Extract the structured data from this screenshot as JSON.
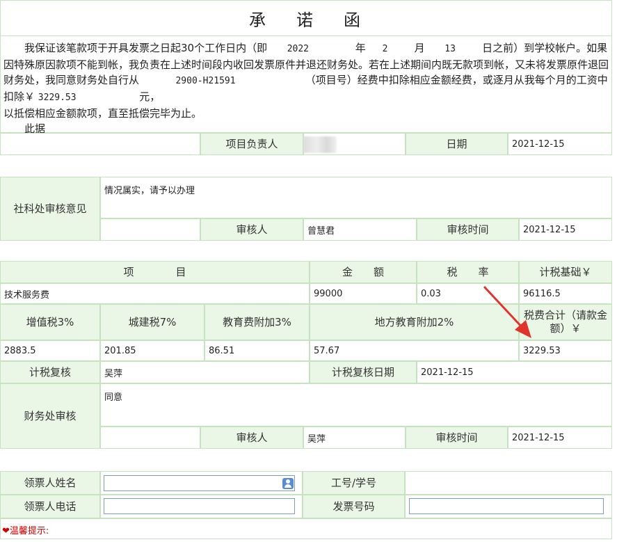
{
  "title": {
    "part1": "承",
    "part2": "诺",
    "part3": "函"
  },
  "pledge": {
    "text1": "我保证该笔款项于开具发票之日起30个工作日内（即",
    "year": "2022",
    "year_unit": "年",
    "month": "2",
    "month_unit": "月",
    "day": "13",
    "text2": "日之前）到学校帐户。如果因特殊原因款项不能到帐，我负责在上述时间段内收回发票原件并退还财务处。若在上述期间内既无款项到帐，又未将发票原件退回财务处，我同意财务处自行从",
    "project_no": "2900-H21591",
    "text3": "（项目号）经费中扣除相应金额经费，或逐月从我每个月的工资中扣除￥",
    "amount": "3229.53",
    "text4": "元，",
    "text5": "以抵偿相应金额款项，直至抵偿完毕为止。",
    "text6": "此据"
  },
  "signer": {
    "label": "项目负责人",
    "date_label": "日期",
    "date": "2021-12-15"
  },
  "social_review": {
    "label": "社科处审核意见",
    "opinion": "情况属实，请予以办理",
    "reviewer_label": "审核人",
    "reviewer": "曾慧君",
    "time_label": "审核时间",
    "time": "2021-12-15"
  },
  "tax_table": {
    "h_item": "项　　　　目",
    "h_amount": "金　　额",
    "h_rate": "税　　率",
    "h_base": "计税基础￥",
    "item": "技术服务费",
    "amount": "99000",
    "rate": "0.03",
    "base": "96116.5",
    "h_vat": "增值税3%",
    "h_city": "城建税7%",
    "h_edu": "教育费附加3%",
    "h_local_edu": "地方教育附加2%",
    "h_total": "税费合计（请款金额）￥",
    "vat": "2883.5",
    "city": "201.85",
    "edu": "86.51",
    "local_edu": "57.67",
    "total": "3229.53",
    "check_label": "计税复核",
    "checker": "吴萍",
    "check_date_label": "计税复核日期",
    "check_date": "2021-12-15"
  },
  "finance_review": {
    "label": "财务处审核",
    "opinion": "同意",
    "reviewer_label": "审核人",
    "reviewer": "吴萍",
    "time_label": "审核时间",
    "time": "2021-12-15"
  },
  "receiver": {
    "name_label": "领票人姓名",
    "id_label": "工号/学号",
    "phone_label": "领票人电话",
    "invoice_label": "发票号码",
    "name_value": "",
    "phone_value": "",
    "invoice_value": ""
  },
  "tip": "❤温馨提示:",
  "colors": {
    "label_bg": "#ebf7e6",
    "border": "#c6e3bf",
    "arrow": "#e0342b",
    "tip": "#d40000"
  }
}
